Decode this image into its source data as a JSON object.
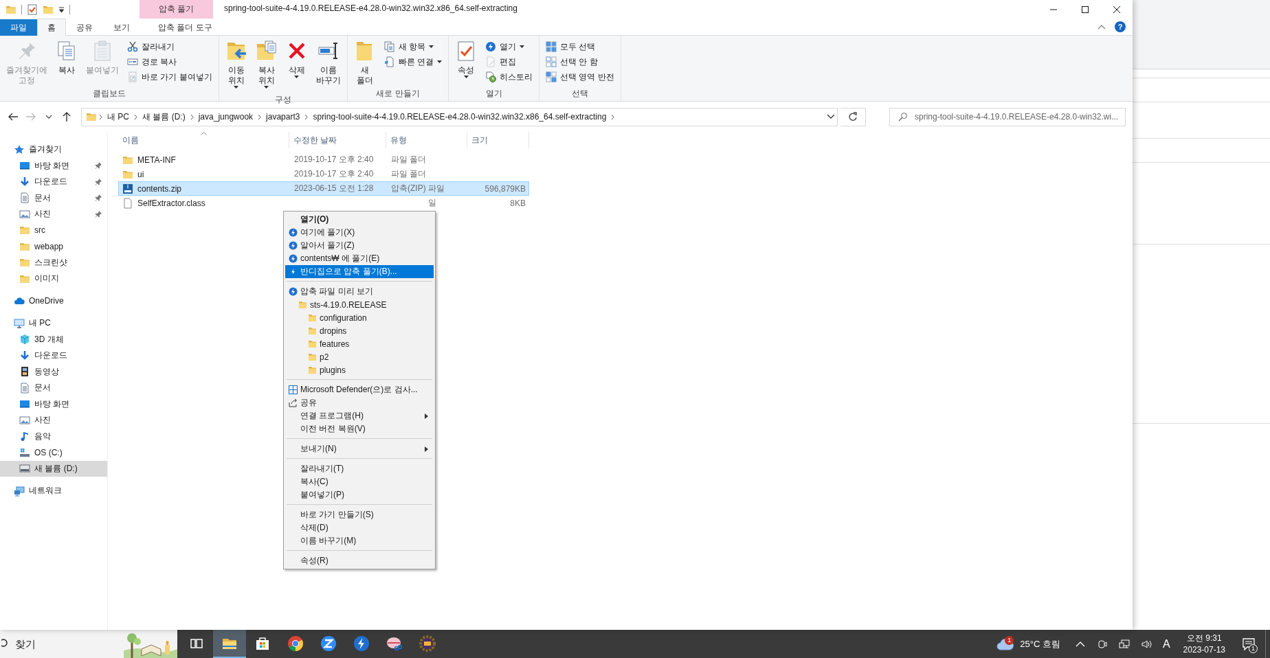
{
  "window": {
    "title": "spring-tool-suite-4-4.19.0.RELEASE-e4.28.0-win32.win32.x86_64.self-extracting",
    "tool_group": "압축 풀기",
    "help": "?"
  },
  "ribbon_tabs": [
    {
      "label": "파일",
      "kind": "file",
      "selected": false
    },
    {
      "label": "홈",
      "kind": "tab",
      "selected": true
    },
    {
      "label": "공유",
      "kind": "tab",
      "selected": false
    },
    {
      "label": "보기",
      "kind": "tab",
      "selected": false
    },
    {
      "label": "압축 폴더 도구",
      "kind": "contextual",
      "selected": false
    }
  ],
  "ribbon_groups": [
    {
      "title": "클립보드",
      "buttons": [
        {
          "kind": "large",
          "label": [
            "즐겨찾기에",
            "고정"
          ],
          "dropdown": false,
          "disabled": true
        },
        {
          "kind": "large",
          "label": [
            "복사"
          ],
          "dropdown": false,
          "disabled": false
        },
        {
          "kind": "large",
          "label": [
            "붙여넣기"
          ],
          "dropdown": false,
          "disabled": true
        },
        {
          "kind": "small",
          "label": [
            "잘라내기"
          ],
          "dropdown": false,
          "disabled": false
        },
        {
          "kind": "small",
          "label": [
            "경로 복사"
          ],
          "dropdown": false,
          "disabled": false
        },
        {
          "kind": "small",
          "label": [
            "바로 가기 붙여넣기"
          ],
          "dropdown": false,
          "disabled": true
        }
      ]
    },
    {
      "title": "구성",
      "buttons": [
        {
          "kind": "large",
          "label": [
            "이동",
            "위치"
          ],
          "dropdown": true,
          "disabled": false
        },
        {
          "kind": "large",
          "label": [
            "복사",
            "위치"
          ],
          "dropdown": true,
          "disabled": false
        },
        {
          "kind": "large",
          "label": [
            "삭제"
          ],
          "dropdown": true,
          "disabled": false
        },
        {
          "kind": "large",
          "label": [
            "이름",
            "바꾸기"
          ],
          "dropdown": false,
          "disabled": false
        }
      ]
    },
    {
      "title": "새로 만들기",
      "buttons": [
        {
          "kind": "large",
          "label": [
            "새",
            "폴더"
          ],
          "dropdown": false,
          "disabled": false
        },
        {
          "kind": "small",
          "label": [
            "새 항목"
          ],
          "dropdown": true,
          "disabled": false
        },
        {
          "kind": "small",
          "label": [
            "빠른 연결"
          ],
          "dropdown": true,
          "disabled": false
        }
      ]
    },
    {
      "title": "열기",
      "buttons": [
        {
          "kind": "large",
          "label": [
            "속성"
          ],
          "dropdown": true,
          "disabled": false
        },
        {
          "kind": "small",
          "label": [
            "열기"
          ],
          "dropdown": true,
          "disabled": false
        },
        {
          "kind": "small",
          "label": [
            "편집"
          ],
          "dropdown": false,
          "disabled": true
        },
        {
          "kind": "small",
          "label": [
            "히스토리"
          ],
          "dropdown": false,
          "disabled": false
        }
      ]
    },
    {
      "title": "선택",
      "buttons": [
        {
          "kind": "small",
          "label": [
            "모두 선택"
          ],
          "dropdown": false,
          "disabled": false
        },
        {
          "kind": "small",
          "label": [
            "선택 안 함"
          ],
          "dropdown": false,
          "disabled": false
        },
        {
          "kind": "small",
          "label": [
            "선택 영역 반전"
          ],
          "dropdown": false,
          "disabled": false
        }
      ]
    }
  ],
  "address": {
    "segments": [
      "내 PC",
      "새 볼륨 (D:)",
      "java_jungwook",
      "javapart3",
      "spring-tool-suite-4-4.19.0.RELEASE-e4.28.0-win32.win32.x86_64.self-extracting"
    ]
  },
  "search": {
    "placeholder": "spring-tool-suite-4-4.19.0.RELEASE-e4.28.0-win32.wi..."
  },
  "sidebar": [
    {
      "label": "즐겨찾기",
      "kind": "star",
      "selected": false,
      "children": [
        {
          "label": "바탕 화면",
          "kind": "desktop",
          "pinned": true,
          "selected": false
        },
        {
          "label": "다운로드",
          "kind": "download",
          "pinned": true,
          "selected": false
        },
        {
          "label": "문서",
          "kind": "document",
          "pinned": true,
          "selected": false
        },
        {
          "label": "사진",
          "pinned": true,
          "selected": false
        },
        {
          "label": "src",
          "kind": "folder",
          "pinned": false,
          "selected": false
        },
        {
          "label": "webapp",
          "kind": "folder",
          "pinned": false,
          "selected": false
        },
        {
          "label": "스크린샷",
          "kind": "folder",
          "pinned": false,
          "selected": false
        },
        {
          "label": "이미지",
          "kind": "folder",
          "pinned": false,
          "selected": false
        }
      ]
    },
    {
      "label": "OneDrive",
      "kind": "cloud",
      "selected": false
    },
    {
      "label": "내 PC",
      "kind": "pc",
      "selected": false,
      "children": [
        {
          "label": "3D 개체",
          "kind": "cube",
          "selected": false
        },
        {
          "label": "다운로드",
          "kind": "download",
          "selected": false
        },
        {
          "label": "동영상",
          "kind": "video",
          "selected": false
        },
        {
          "label": "문서",
          "kind": "document",
          "selected": false
        },
        {
          "label": "바탕 화면",
          "kind": "desktop",
          "selected": false
        },
        {
          "label": "사진",
          "selected": false
        },
        {
          "label": "음악",
          "kind": "music",
          "selected": false
        },
        {
          "label": "OS (C:)",
          "kind": "system-drive",
          "selected": false
        },
        {
          "label": "새 볼륨 (D:)",
          "kind": "drive",
          "selected": true
        }
      ]
    },
    {
      "label": "네트워크",
      "kind": "network",
      "selected": false
    }
  ],
  "file_list": {
    "columns": [
      {
        "label": "이름",
        "sorted": true
      },
      {
        "label": "수정한 날짜",
        "sorted": false
      },
      {
        "label": "유형",
        "sorted": false
      },
      {
        "label": "크기",
        "sorted": false
      }
    ],
    "rows": [
      {
        "name": "META-INF",
        "kind": "folder",
        "modified": "2019-10-17 오후 2:40",
        "type": "파일 폴더",
        "selected": false
      },
      {
        "name": "ui",
        "kind": "folder",
        "modified": "2019-10-17 오후 2:40",
        "type": "파일 폴더",
        "selected": false
      },
      {
        "name": "contents.zip",
        "kind": "archive",
        "modified": "2023-06-15 오전 1:28",
        "type": "압축(ZIP) 파일",
        "size": "596,879KB",
        "selected": true
      },
      {
        "name": "SelfExtractor.class",
        "kind": "file",
        "type": "일",
        "size": "8KB",
        "selected": false
      }
    ]
  },
  "context_menu": [
    {
      "label": "열기(O)",
      "kind": "plain",
      "default": true,
      "submenu": false,
      "selected": false
    },
    {
      "label": "여기에 풀기(X)",
      "kind": "app",
      "default": false,
      "submenu": false,
      "selected": false
    },
    {
      "label": "알아서 풀기(Z)",
      "kind": "app",
      "default": false,
      "submenu": false,
      "selected": false
    },
    {
      "label": "contents₩ 에 풀기(E)",
      "kind": "app",
      "default": false,
      "submenu": false,
      "selected": false
    },
    {
      "label": "반디집으로 압축 풀기(B)...",
      "kind": "launch",
      "default": false,
      "submenu": false,
      "selected": true
    },
    {
      "kind": "separator"
    },
    {
      "label": "압축 파일 미리 보기",
      "kind": "app",
      "default": false,
      "submenu": false,
      "selected": false,
      "children": [
        {
          "label": "sts-4.19.0.RELEASE",
          "kind": "folder",
          "default": false,
          "submenu": false,
          "selected": false,
          "children": [
            {
              "label": "configuration",
              "kind": "folder",
              "default": false,
              "submenu": false,
              "selected": false
            },
            {
              "label": "dropins",
              "kind": "folder",
              "default": false,
              "submenu": false,
              "selected": false
            },
            {
              "label": "features",
              "kind": "folder",
              "default": false,
              "submenu": false,
              "selected": false
            },
            {
              "label": "p2",
              "kind": "folder",
              "default": false,
              "submenu": false,
              "selected": false
            },
            {
              "label": "plugins",
              "kind": "folder",
              "default": false,
              "submenu": false,
              "selected": false
            }
          ]
        }
      ]
    },
    {
      "kind": "separator"
    },
    {
      "label": "Microsoft Defender(으)로 검사...",
      "kind": "shield",
      "default": false,
      "submenu": false,
      "selected": false
    },
    {
      "label": "공유",
      "kind": "share",
      "default": false,
      "submenu": false,
      "selected": false
    },
    {
      "label": "연결 프로그램(H)",
      "kind": "plain",
      "default": false,
      "submenu": true,
      "selected": false
    },
    {
      "label": "이전 버전 복원(V)",
      "kind": "plain",
      "default": false,
      "submenu": false,
      "selected": false
    },
    {
      "kind": "separator"
    },
    {
      "label": "보내기(N)",
      "kind": "plain",
      "default": false,
      "submenu": true,
      "selected": false
    },
    {
      "kind": "separator"
    },
    {
      "label": "잘라내기(T)",
      "kind": "plain",
      "default": false,
      "submenu": false,
      "selected": false
    },
    {
      "label": "복사(C)",
      "kind": "plain",
      "default": false,
      "submenu": false,
      "selected": false
    },
    {
      "label": "붙여넣기(P)",
      "kind": "plain",
      "default": false,
      "submenu": false,
      "selected": false
    },
    {
      "kind": "separator"
    },
    {
      "label": "바로 가기 만들기(S)",
      "kind": "plain",
      "default": false,
      "submenu": false,
      "selected": false
    },
    {
      "label": "삭제(D)",
      "kind": "plain",
      "default": false,
      "submenu": false,
      "selected": false
    },
    {
      "label": "이름 바꾸기(M)",
      "kind": "plain",
      "default": false,
      "submenu": false,
      "selected": false
    },
    {
      "kind": "separator"
    },
    {
      "label": "속성(R)",
      "kind": "plain",
      "default": false,
      "submenu": false,
      "selected": false
    }
  ],
  "taskbar": {
    "search": {
      "placeholder": "찾기"
    },
    "apps": [
      {
        "kind": "task-view",
        "selected": false
      },
      {
        "kind": "file-explorer",
        "selected": true
      },
      {
        "kind": "store",
        "selected": false
      },
      {
        "kind": "browser",
        "selected": false
      },
      {
        "kind": "meeting",
        "selected": false
      },
      {
        "kind": "bandizip",
        "selected": false
      },
      {
        "kind": "snipping",
        "selected": false
      },
      {
        "kind": "ide",
        "selected": false
      }
    ],
    "weather": {
      "badge": "1",
      "text": "25°C 흐림"
    },
    "input_indicator": "A",
    "time": "오전 9:31",
    "date": "2023-07-13",
    "notification_badge": "1"
  }
}
